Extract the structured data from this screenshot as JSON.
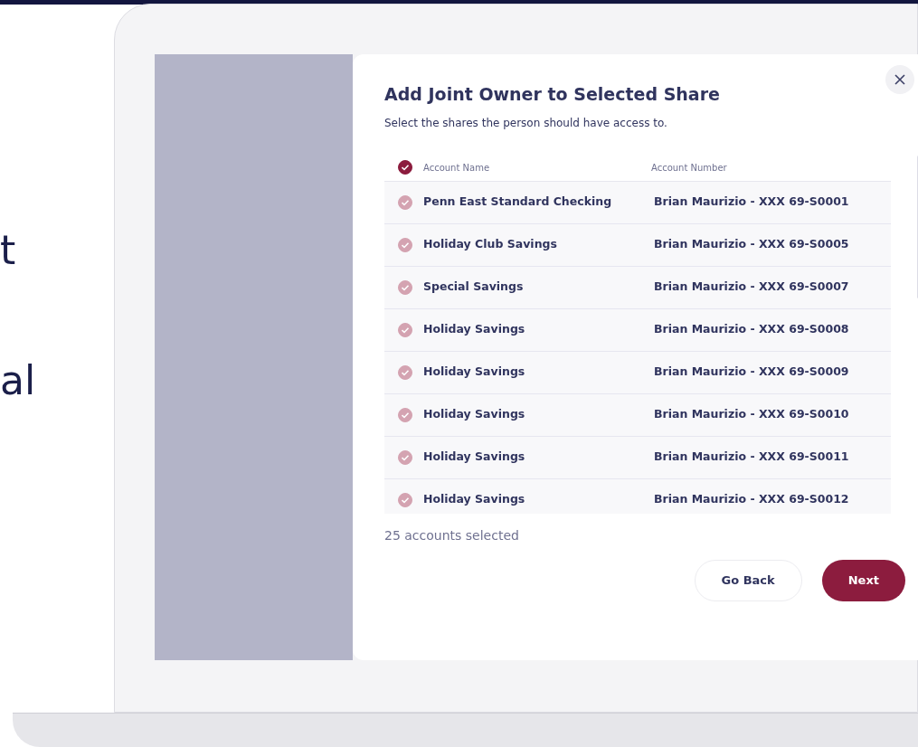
{
  "slide_text": [
    "t",
    "al"
  ],
  "dialog": {
    "title": "Add Joint Owner to Selected Share",
    "subtitle": "Select the shares the person should have access to.",
    "header": {
      "checked": true,
      "columns": [
        "Account Name",
        "Account Number"
      ]
    },
    "rows": [
      {
        "name": "Penn East Standard Checking",
        "number": "Brian Maurizio - XXX 69-S0001",
        "checked": true
      },
      {
        "name": "Holiday Club Savings",
        "number": "Brian Maurizio - XXX 69-S0005",
        "checked": true
      },
      {
        "name": "Special Savings",
        "number": "Brian Maurizio - XXX 69-S0007",
        "checked": true
      },
      {
        "name": "Holiday Savings",
        "number": "Brian Maurizio - XXX 69-S0008",
        "checked": true
      },
      {
        "name": "Holiday Savings",
        "number": "Brian Maurizio - XXX 69-S0009",
        "checked": true
      },
      {
        "name": "Holiday Savings",
        "number": "Brian Maurizio - XXX 69-S0010",
        "checked": true
      },
      {
        "name": "Holiday Savings",
        "number": "Brian Maurizio - XXX 69-S0011",
        "checked": true
      },
      {
        "name": "Holiday Savings",
        "number": "Brian Maurizio - XXX 69-S0012",
        "checked": true
      }
    ],
    "count": "25 accounts selected",
    "buttons": [
      {
        "label": "Go Back",
        "kind": "secondary"
      },
      {
        "label": "Next",
        "kind": "primary"
      }
    ]
  }
}
